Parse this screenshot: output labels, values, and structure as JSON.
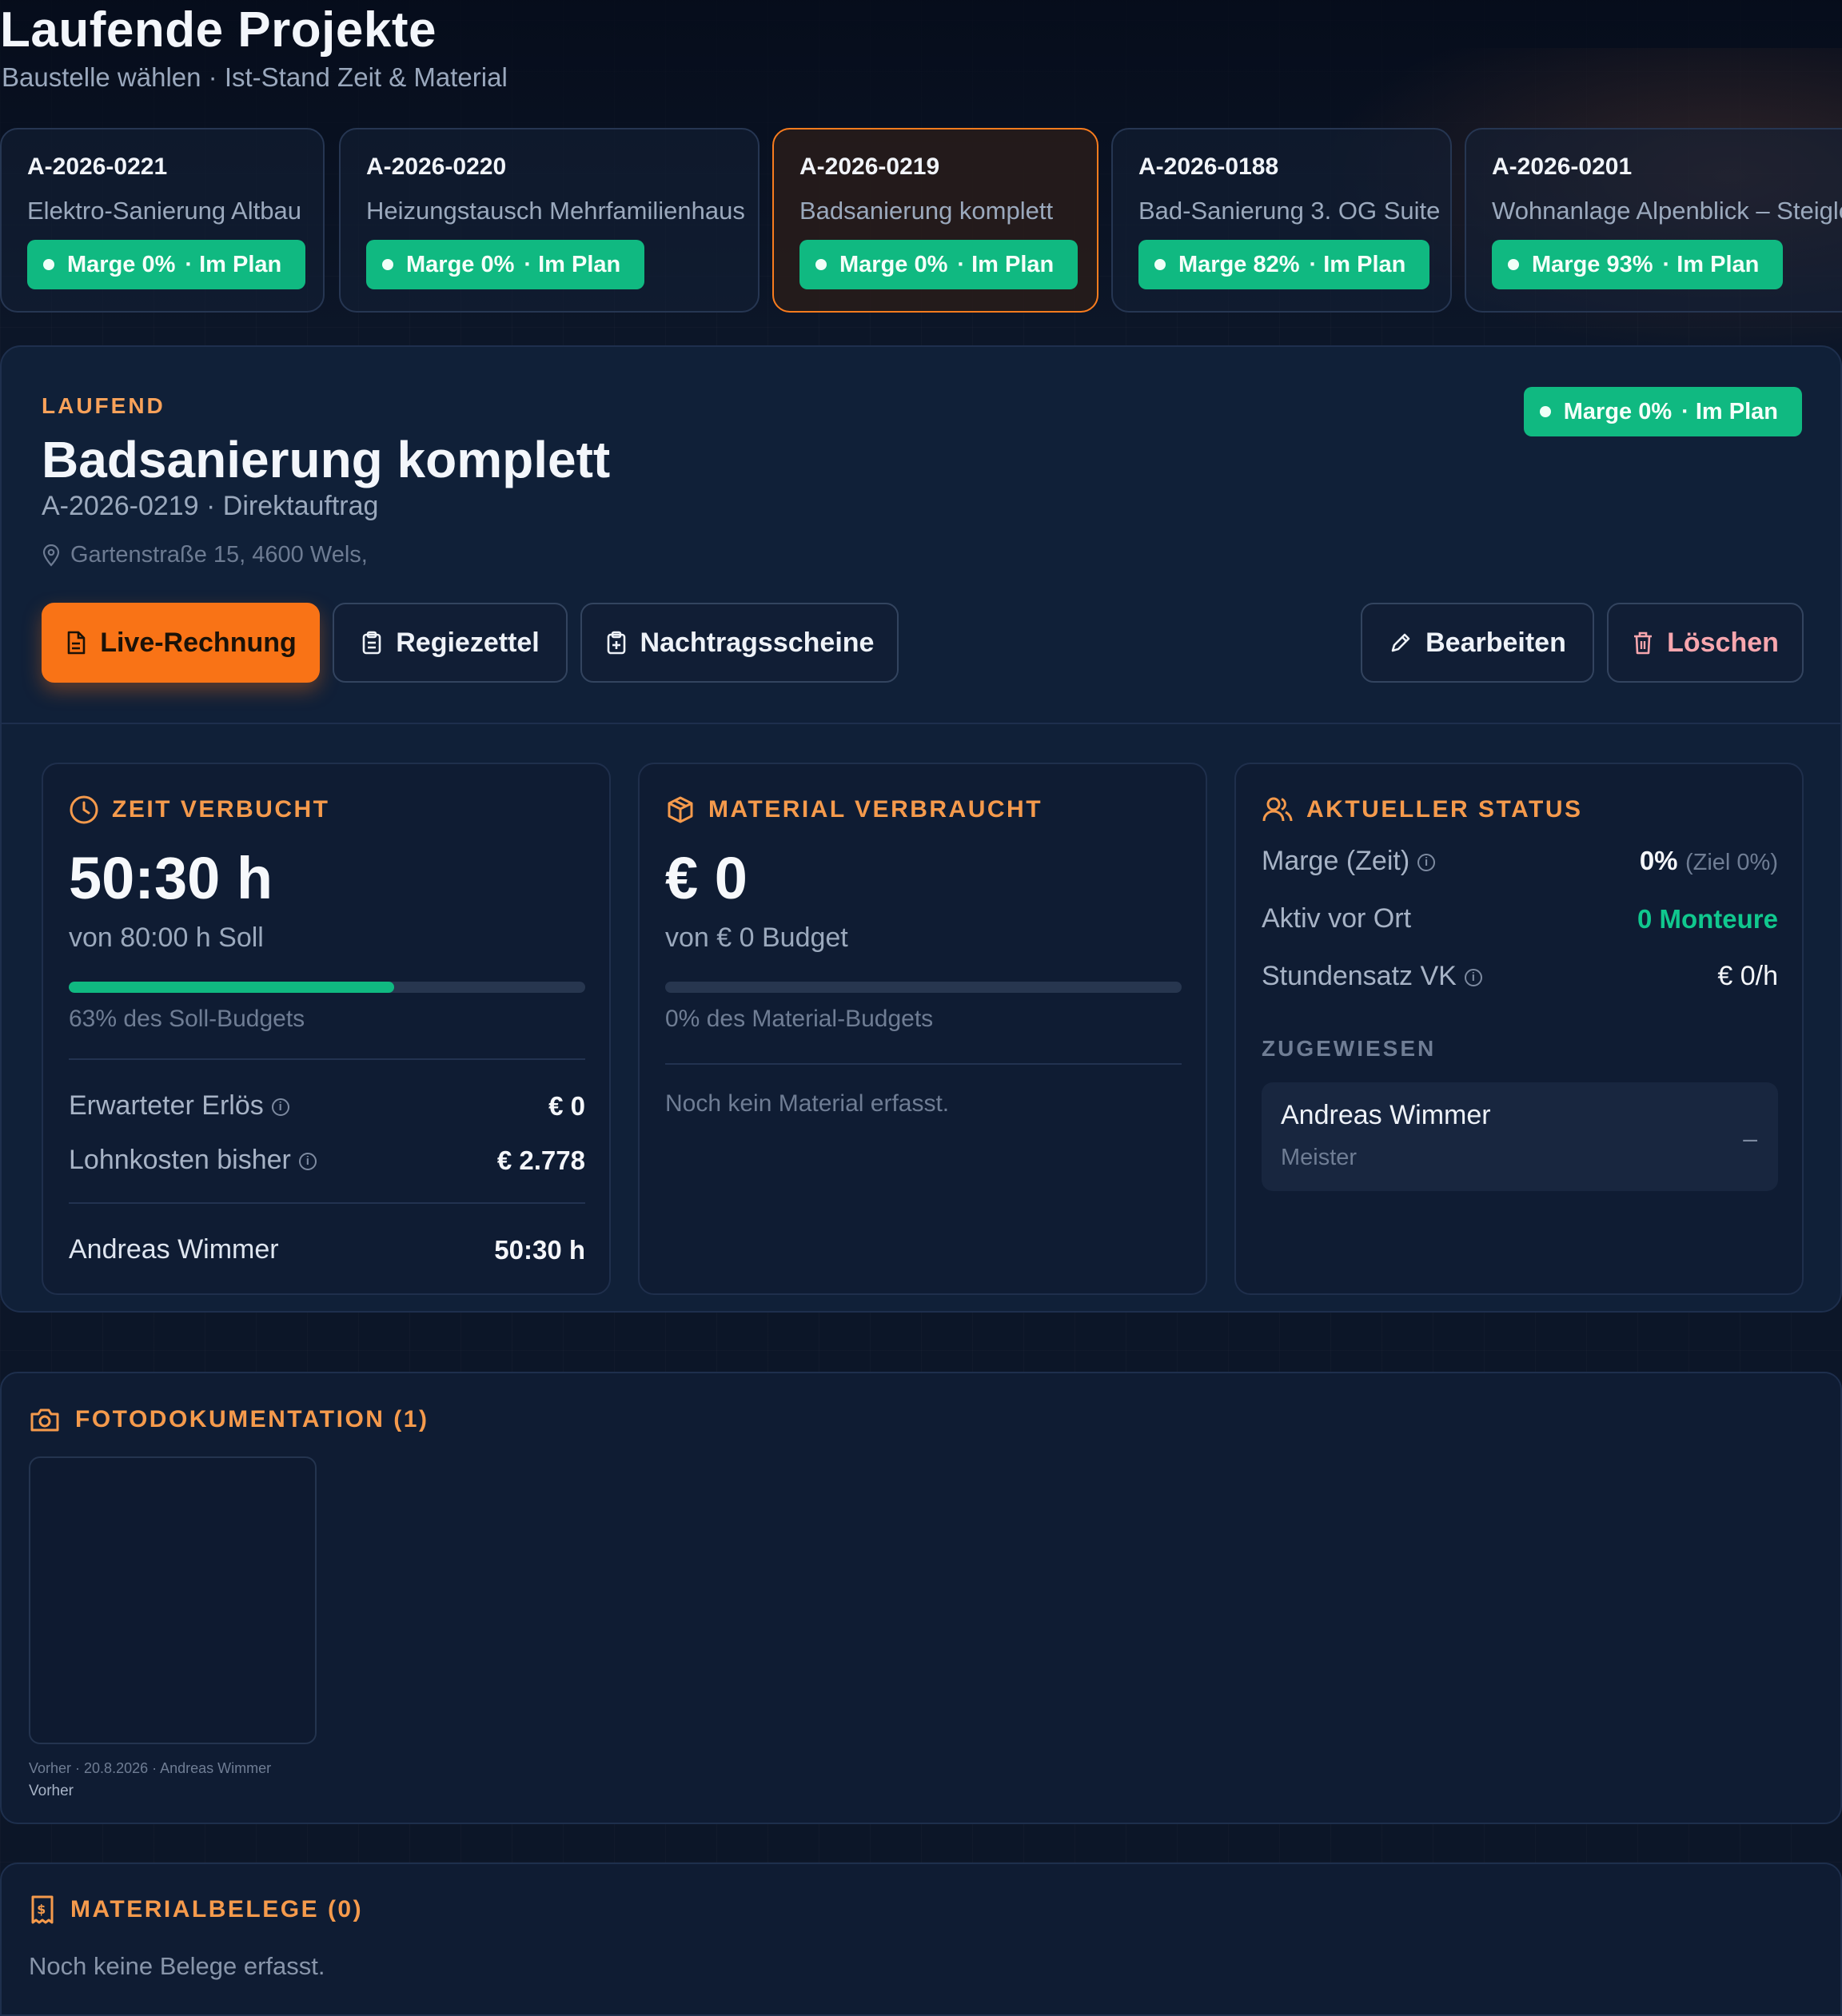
{
  "header": {
    "title": "Laufende Projekte",
    "subtitle": "Baustelle wählen · Ist-Stand Zeit & Material"
  },
  "projects": [
    {
      "number": "A-2026-0221",
      "name": "Elektro-Sanierung Altbau",
      "badge": "Marge 0%",
      "status": "· Im Plan"
    },
    {
      "number": "A-2026-0220",
      "name": "Heizungstausch Mehrfamilienhaus",
      "badge": "Marge 0%",
      "status": "· Im Plan"
    },
    {
      "number": "A-2026-0219",
      "name": "Badsanierung komplett",
      "badge": "Marge 0%",
      "status": "· Im Plan",
      "active": true
    },
    {
      "number": "A-2026-0188",
      "name": "Bad-Sanierung 3. OG Suite",
      "badge": "Marge 82%",
      "status": "· Im Plan"
    },
    {
      "number": "A-2026-0201",
      "name": "Wohnanlage Alpenblick – Steiglei",
      "badge": "Marge 93%",
      "status": "· Im Plan"
    }
  ],
  "detail": {
    "state": "LAUFEND",
    "title": "Badsanierung komplett",
    "meta": "A-2026-0219 · Direktauftrag",
    "address": "Gartenstraße 15, 4600 Wels,",
    "badge": "Marge 0%",
    "badge_status": "· Im Plan",
    "buttons": {
      "live_invoice": "Live-Rechnung",
      "regiezettel": "Regiezettel",
      "nachtrag": "Nachtragsscheine",
      "edit": "Bearbeiten",
      "delete": "Löschen"
    }
  },
  "time_card": {
    "heading": "ZEIT VERBUCHT",
    "value": "50:30 h",
    "target": "von 80:00 h Soll",
    "progress_percent": 63,
    "progress_note": "63% des Soll-Budgets",
    "expected_revenue_label": "Erwarteter Erlös",
    "expected_revenue_value": "€ 0",
    "labor_cost_label": "Lohnkosten bisher",
    "labor_cost_value": "€ 2.778",
    "worker_name": "Andreas Wimmer",
    "worker_hours": "50:30 h"
  },
  "material_card": {
    "heading": "MATERIAL VERBRAUCHT",
    "value": "€ 0",
    "budget": "von € 0 Budget",
    "progress_percent": 0,
    "progress_note": "0% des Material-Budgets",
    "empty": "Noch kein Material erfasst."
  },
  "status_card": {
    "heading": "AKTUELLER STATUS",
    "margin_label": "Marge (Zeit)",
    "margin_value": "0%",
    "margin_target": "(Ziel 0%)",
    "active_label": "Aktiv vor Ort",
    "active_value": "0 Monteure",
    "rate_label": "Stundensatz VK",
    "rate_value": "€ 0/h",
    "assigned_heading": "ZUGEWIESEN",
    "assigned": [
      {
        "name": "Andreas Wimmer",
        "role": "Meister",
        "action": "–"
      }
    ]
  },
  "photos": {
    "heading": "FOTODOKUMENTATION (1)",
    "items": [
      {
        "caption": "Vorher · 20.8.2026 · Andreas Wimmer",
        "tag": "Vorher"
      }
    ]
  },
  "receipts": {
    "heading": "MATERIALBELEGE (0)",
    "empty": "Noch keine Belege erfasst."
  },
  "colors": {
    "accent": "#f97316",
    "success": "#10b981",
    "background": "#0c1628",
    "section_heading": "#f59a4c"
  }
}
